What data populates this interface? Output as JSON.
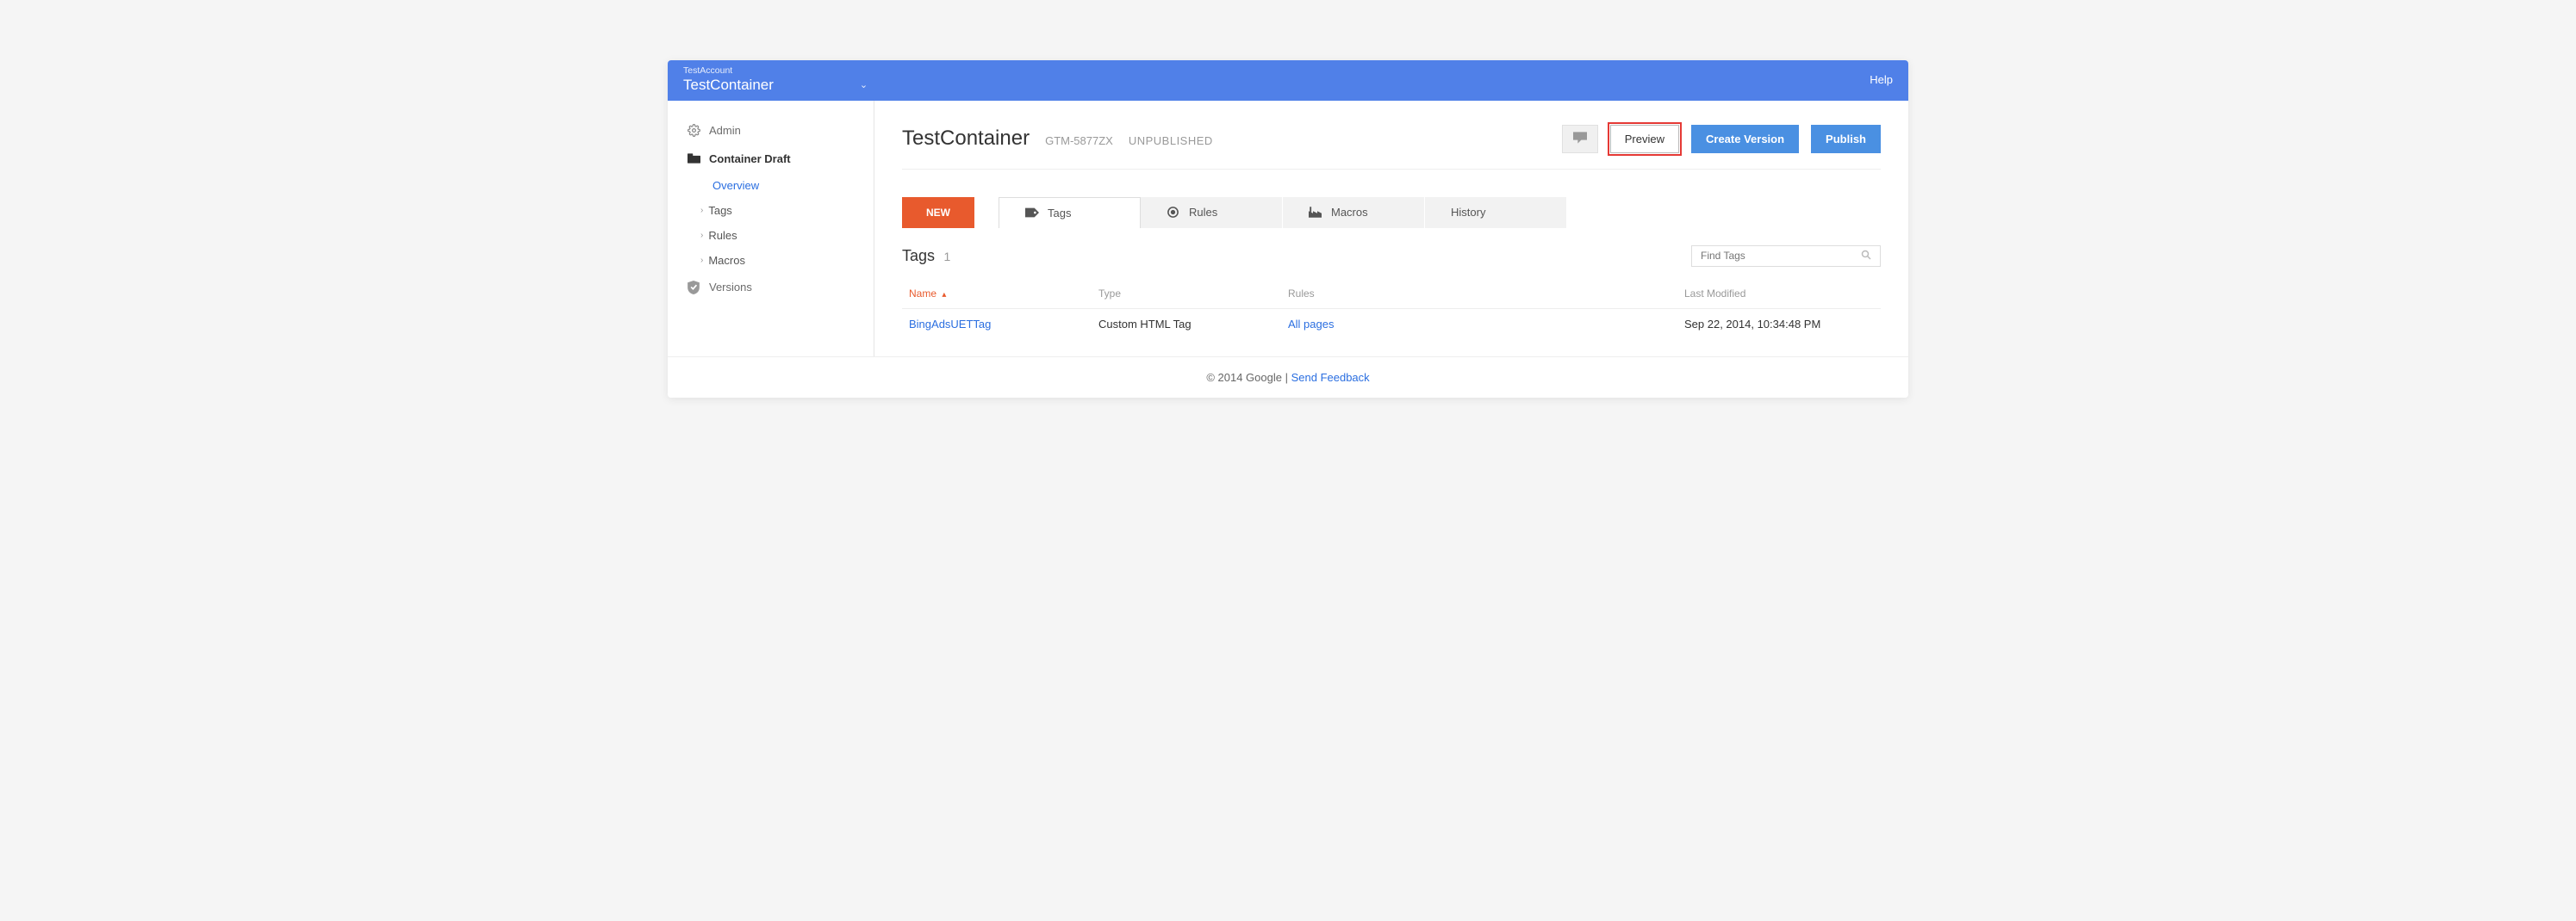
{
  "header": {
    "account": "TestAccount",
    "container": "TestContainer",
    "help": "Help"
  },
  "sidebar": {
    "admin": "Admin",
    "draft": "Container Draft",
    "items": [
      {
        "label": "Overview"
      },
      {
        "label": "Tags"
      },
      {
        "label": "Rules"
      },
      {
        "label": "Macros"
      }
    ],
    "versions": "Versions"
  },
  "page": {
    "title": "TestContainer",
    "container_id": "GTM-5877ZX",
    "status": "UNPUBLISHED",
    "preview": "Preview",
    "create_version": "Create Version",
    "publish": "Publish"
  },
  "tabs": {
    "new": "NEW",
    "items": [
      {
        "label": "Tags"
      },
      {
        "label": "Rules"
      },
      {
        "label": "Macros"
      },
      {
        "label": "History"
      }
    ]
  },
  "section": {
    "title": "Tags",
    "count": "1",
    "search_placeholder": "Find Tags"
  },
  "table": {
    "headers": {
      "name": "Name",
      "type": "Type",
      "rules": "Rules",
      "last_modified": "Last Modified"
    },
    "rows": [
      {
        "name": "BingAdsUETTag",
        "type": "Custom HTML Tag",
        "rules": "All pages",
        "last_modified": "Sep 22, 2014, 10:34:48 PM"
      }
    ]
  },
  "footer": {
    "copyright": "© 2014 Google",
    "sep": " | ",
    "feedback": "Send Feedback"
  }
}
